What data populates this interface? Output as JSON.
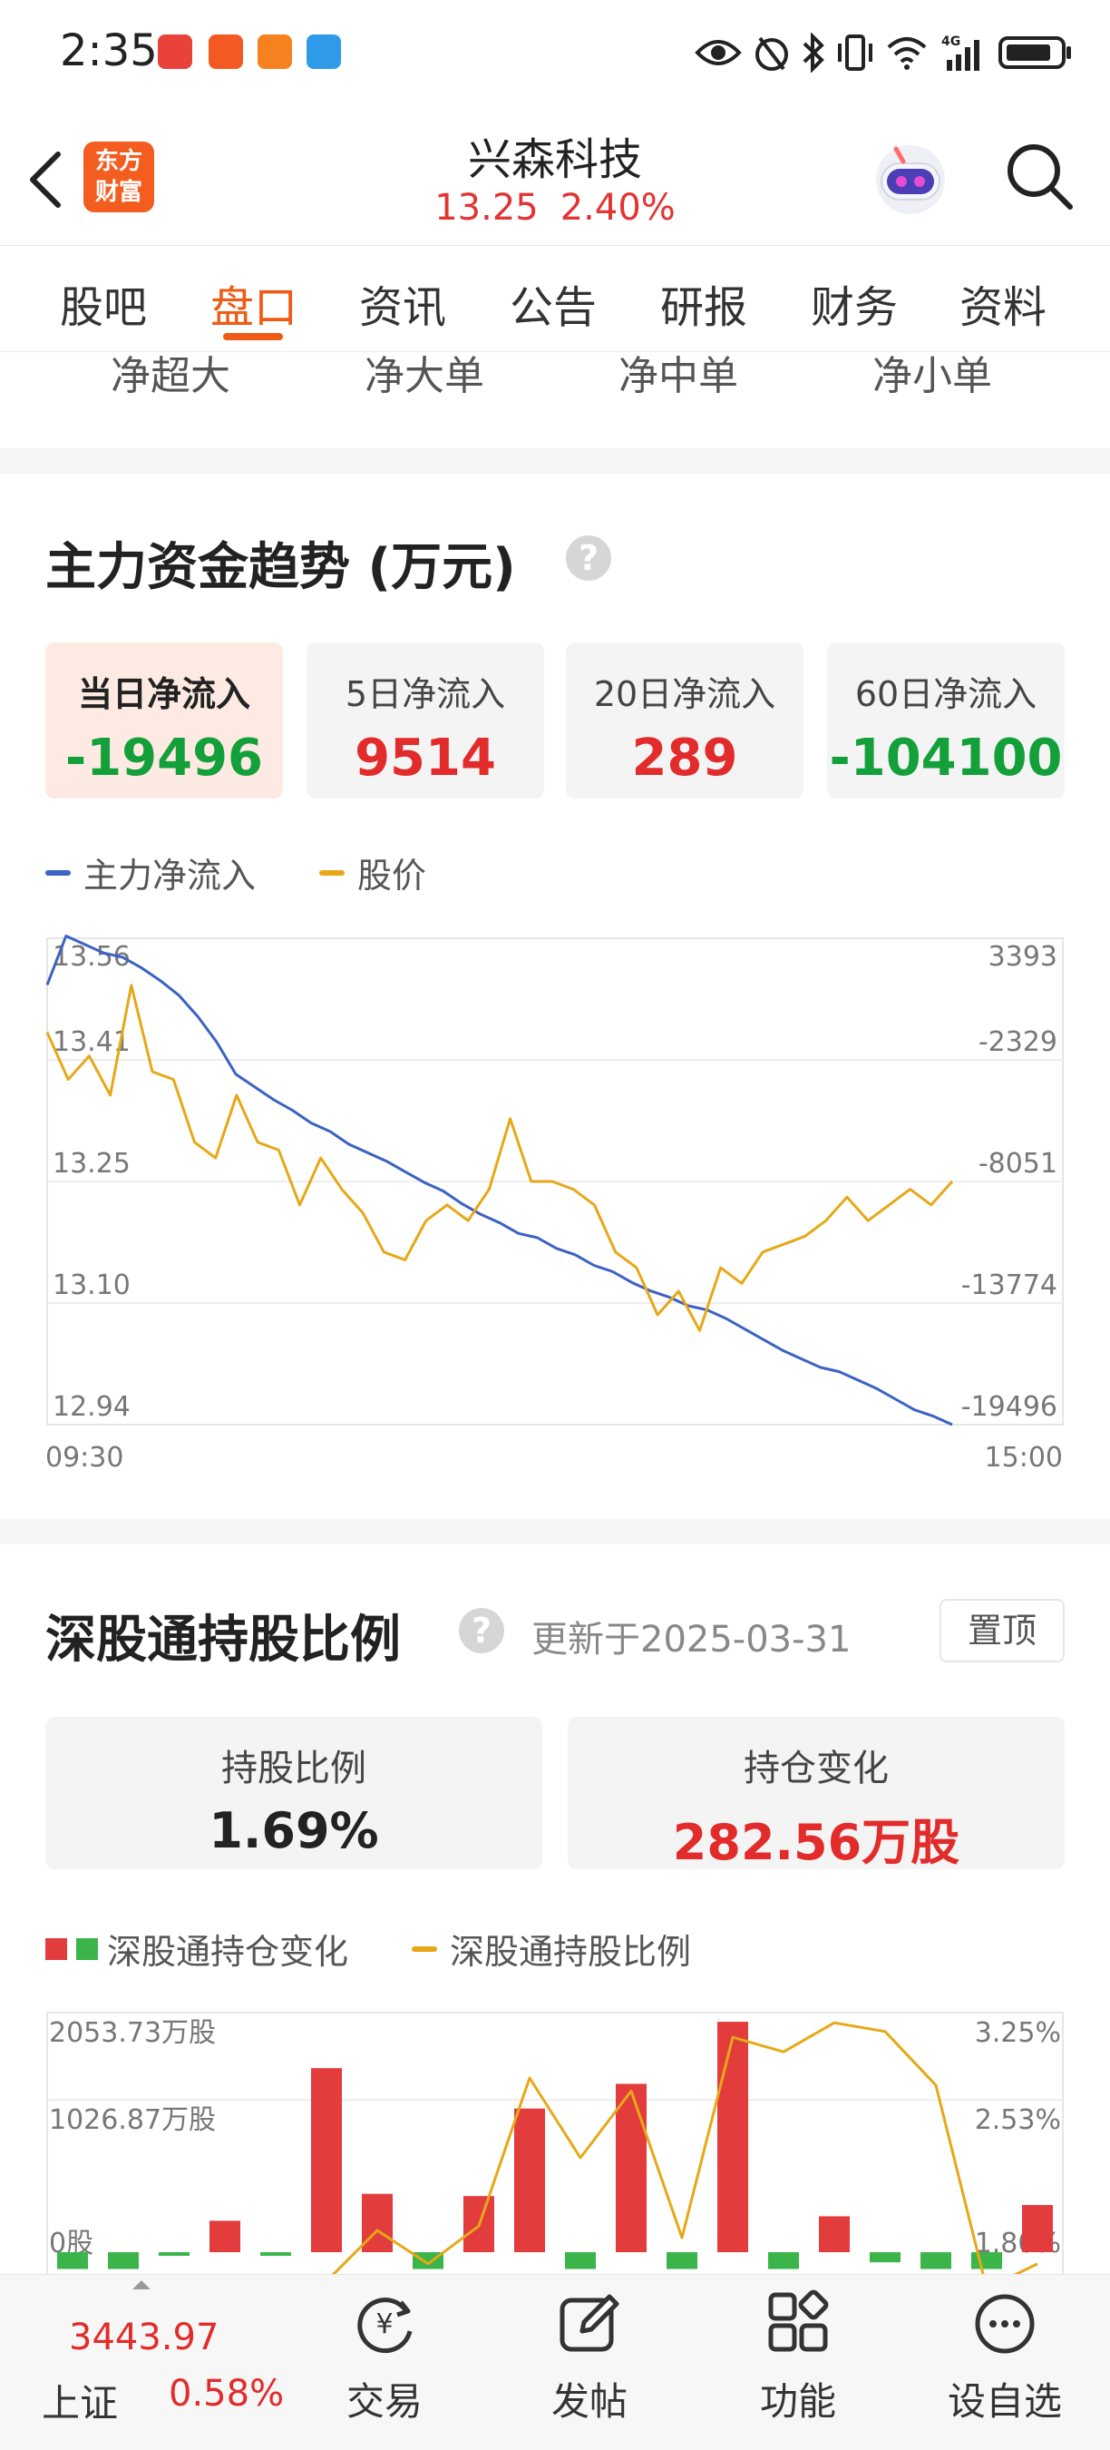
{
  "status_bar": {
    "time": "2:35",
    "notification_icons": [
      {
        "name": "huawei-app-icon",
        "color": "#e8423a"
      },
      {
        "name": "paper-plane-app-icon",
        "color": "#f25a22"
      },
      {
        "name": "video-play-app-icon",
        "color": "#f5821f"
      },
      {
        "name": "search-app-icon",
        "color": "#2f9be8"
      }
    ],
    "right_icons": [
      "eye-icon",
      "alarm-icon",
      "bluetooth-icon",
      "vibrate-icon",
      "wifi-icon",
      "signal-4g-icon",
      "battery-icon"
    ],
    "network_label": "4G"
  },
  "header": {
    "logo_line1": "东方",
    "logo_line2": "财富",
    "stock_name": "兴森科技",
    "price": "13.25",
    "change_pct": "2.40%"
  },
  "tabs": [
    {
      "label": "股吧",
      "active": false
    },
    {
      "label": "盘口",
      "active": true
    },
    {
      "label": "资讯",
      "active": false
    },
    {
      "label": "公告",
      "active": false
    },
    {
      "label": "研报",
      "active": false
    },
    {
      "label": "财务",
      "active": false
    },
    {
      "label": "资料",
      "active": false
    }
  ],
  "flow_labels": [
    "净超大",
    "净大单",
    "净中单",
    "净小单"
  ],
  "main_flow": {
    "title": "主力资金趋势 (万元)",
    "help_glyph": "?",
    "cards": [
      {
        "label": "当日净流入",
        "value": "-19496",
        "sign": "negative",
        "active": true
      },
      {
        "label": "5日净流入",
        "value": "9514",
        "sign": "positive",
        "active": false
      },
      {
        "label": "20日净流入",
        "value": "289",
        "sign": "positive",
        "active": false
      },
      {
        "label": "60日净流入",
        "value": "-104100",
        "sign": "negative",
        "active": false
      }
    ],
    "legend": [
      {
        "label": "主力净流入",
        "color": "#3b62c4"
      },
      {
        "label": "股价",
        "color": "#e6a817"
      }
    ]
  },
  "shenzhen_connect": {
    "title": "深股通持股比例",
    "help_glyph": "?",
    "update_text": "更新于2025-03-31",
    "pin_label": "置顶",
    "cards": [
      {
        "label": "持股比例",
        "value": "1.69%",
        "sign": "neutral"
      },
      {
        "label": "持仓变化",
        "value": "282.56万股",
        "sign": "positive"
      }
    ],
    "legend": [
      {
        "label": "深股通持仓变化",
        "colors": [
          "#e23c3c",
          "#3bb54a"
        ]
      },
      {
        "label": "深股通持股比例",
        "color": "#e6a817"
      }
    ]
  },
  "chart_data": [
    {
      "type": "line",
      "x_start": "09:30",
      "x_end": "15:00",
      "left_axis_ticks": [
        "13.56",
        "13.41",
        "13.25",
        "13.10",
        "12.94"
      ],
      "right_axis_ticks": [
        "3393",
        "-2329",
        "-8051",
        "-13774",
        "-19496"
      ],
      "grid": true,
      "series": [
        {
          "name": "主力净流入",
          "axis": "right",
          "color": "#3b62c4",
          "values": [
            1200,
            3500,
            3100,
            2700,
            2500,
            2000,
            1400,
            700,
            -300,
            -1500,
            -3000,
            -3600,
            -4200,
            -4700,
            -5300,
            -5700,
            -6300,
            -6700,
            -7100,
            -7600,
            -8100,
            -8500,
            -9100,
            -9600,
            -10000,
            -10500,
            -10700,
            -11200,
            -11500,
            -12000,
            -12300,
            -12800,
            -13200,
            -13500,
            -13900,
            -14100,
            -14500,
            -15000,
            -15500,
            -16000,
            -16400,
            -16800,
            -17000,
            -17400,
            -17800,
            -18300,
            -18800,
            -19100,
            -19496
          ]
        },
        {
          "name": "股价",
          "axis": "left",
          "color": "#e6a817",
          "values": [
            13.44,
            13.38,
            13.41,
            13.36,
            13.5,
            13.39,
            13.38,
            13.3,
            13.28,
            13.36,
            13.3,
            13.29,
            13.22,
            13.28,
            13.24,
            13.21,
            13.16,
            13.15,
            13.2,
            13.22,
            13.2,
            13.24,
            13.33,
            13.25,
            13.25,
            13.24,
            13.22,
            13.16,
            13.14,
            13.08,
            13.11,
            13.06,
            13.14,
            13.12,
            13.16,
            13.17,
            13.18,
            13.2,
            13.23,
            13.2,
            13.22,
            13.24,
            13.22,
            13.25
          ]
        }
      ]
    },
    {
      "type": "bar",
      "left_axis_ticks": [
        "2053.73万股",
        "1026.87万股",
        "0股"
      ],
      "right_axis_ticks": [
        "3.25%",
        "2.53%",
        "1.80%"
      ],
      "series": [
        {
          "name": "深股通持仓变化",
          "unit": "万股",
          "positive_color": "#e23c3c",
          "negative_color": "#3bb54a",
          "values": [
            -150,
            -150,
            -30,
            280,
            -20,
            1640,
            520,
            -150,
            500,
            1280,
            -150,
            1500,
            -150,
            2053,
            -150,
            320,
            -90,
            -150,
            -150,
            420
          ]
        },
        {
          "name": "深股通持股比例",
          "unit": "%",
          "color": "#e6a817",
          "values": [
            1.3,
            1.3,
            1.35,
            1.4,
            1.5,
            1.6,
            1.95,
            1.72,
            1.98,
            3.0,
            2.45,
            2.91,
            1.9,
            3.28,
            3.18,
            3.38,
            3.32,
            2.95,
            1.55,
            1.72
          ]
        }
      ]
    }
  ],
  "bottom_bar": {
    "index_value": "3443.97",
    "index_label": "上证",
    "index_pct": "0.58%",
    "items": [
      {
        "label": "交易",
        "icon": "trade-icon"
      },
      {
        "label": "发帖",
        "icon": "edit-post-icon"
      },
      {
        "label": "功能",
        "icon": "apps-grid-icon"
      },
      {
        "label": "设自选",
        "icon": "more-dots-icon"
      }
    ]
  }
}
